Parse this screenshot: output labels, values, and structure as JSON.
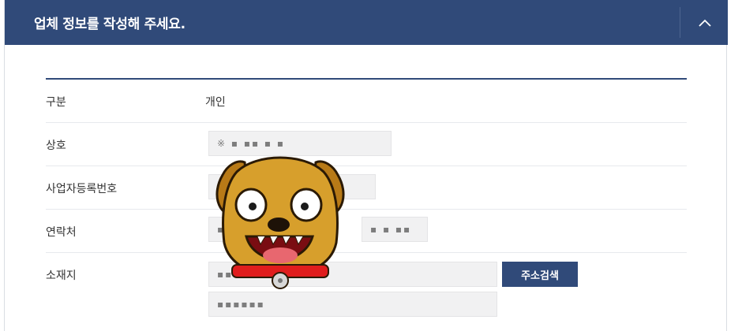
{
  "header": {
    "title": "업체 정보를 작성해 주세요.",
    "collapse_icon": "chevron-up-icon",
    "color": "#304a79"
  },
  "form": {
    "type": {
      "label": "구분",
      "value": "개인"
    },
    "company_name": {
      "label": "상호",
      "value": "※ ▪ ▪▪ ▪ ▪"
    },
    "biz_reg_no": {
      "label": "사업자등록번호",
      "value": "▪ ▪▪ ▪▪ ▪▪▪▪"
    },
    "contact": {
      "label": "연락처",
      "value1": "▪ ▪▪▪",
      "value2": "▪ ▪ ▪▪"
    },
    "address": {
      "label": "소재지",
      "value1": "▪▪ ▪▪ ▪▪ ▪ ▪",
      "value2": "▪▪▪▪▪▪",
      "search_button": "주소검색"
    }
  },
  "overlay": {
    "icon": "dog-character-sticker-icon"
  }
}
